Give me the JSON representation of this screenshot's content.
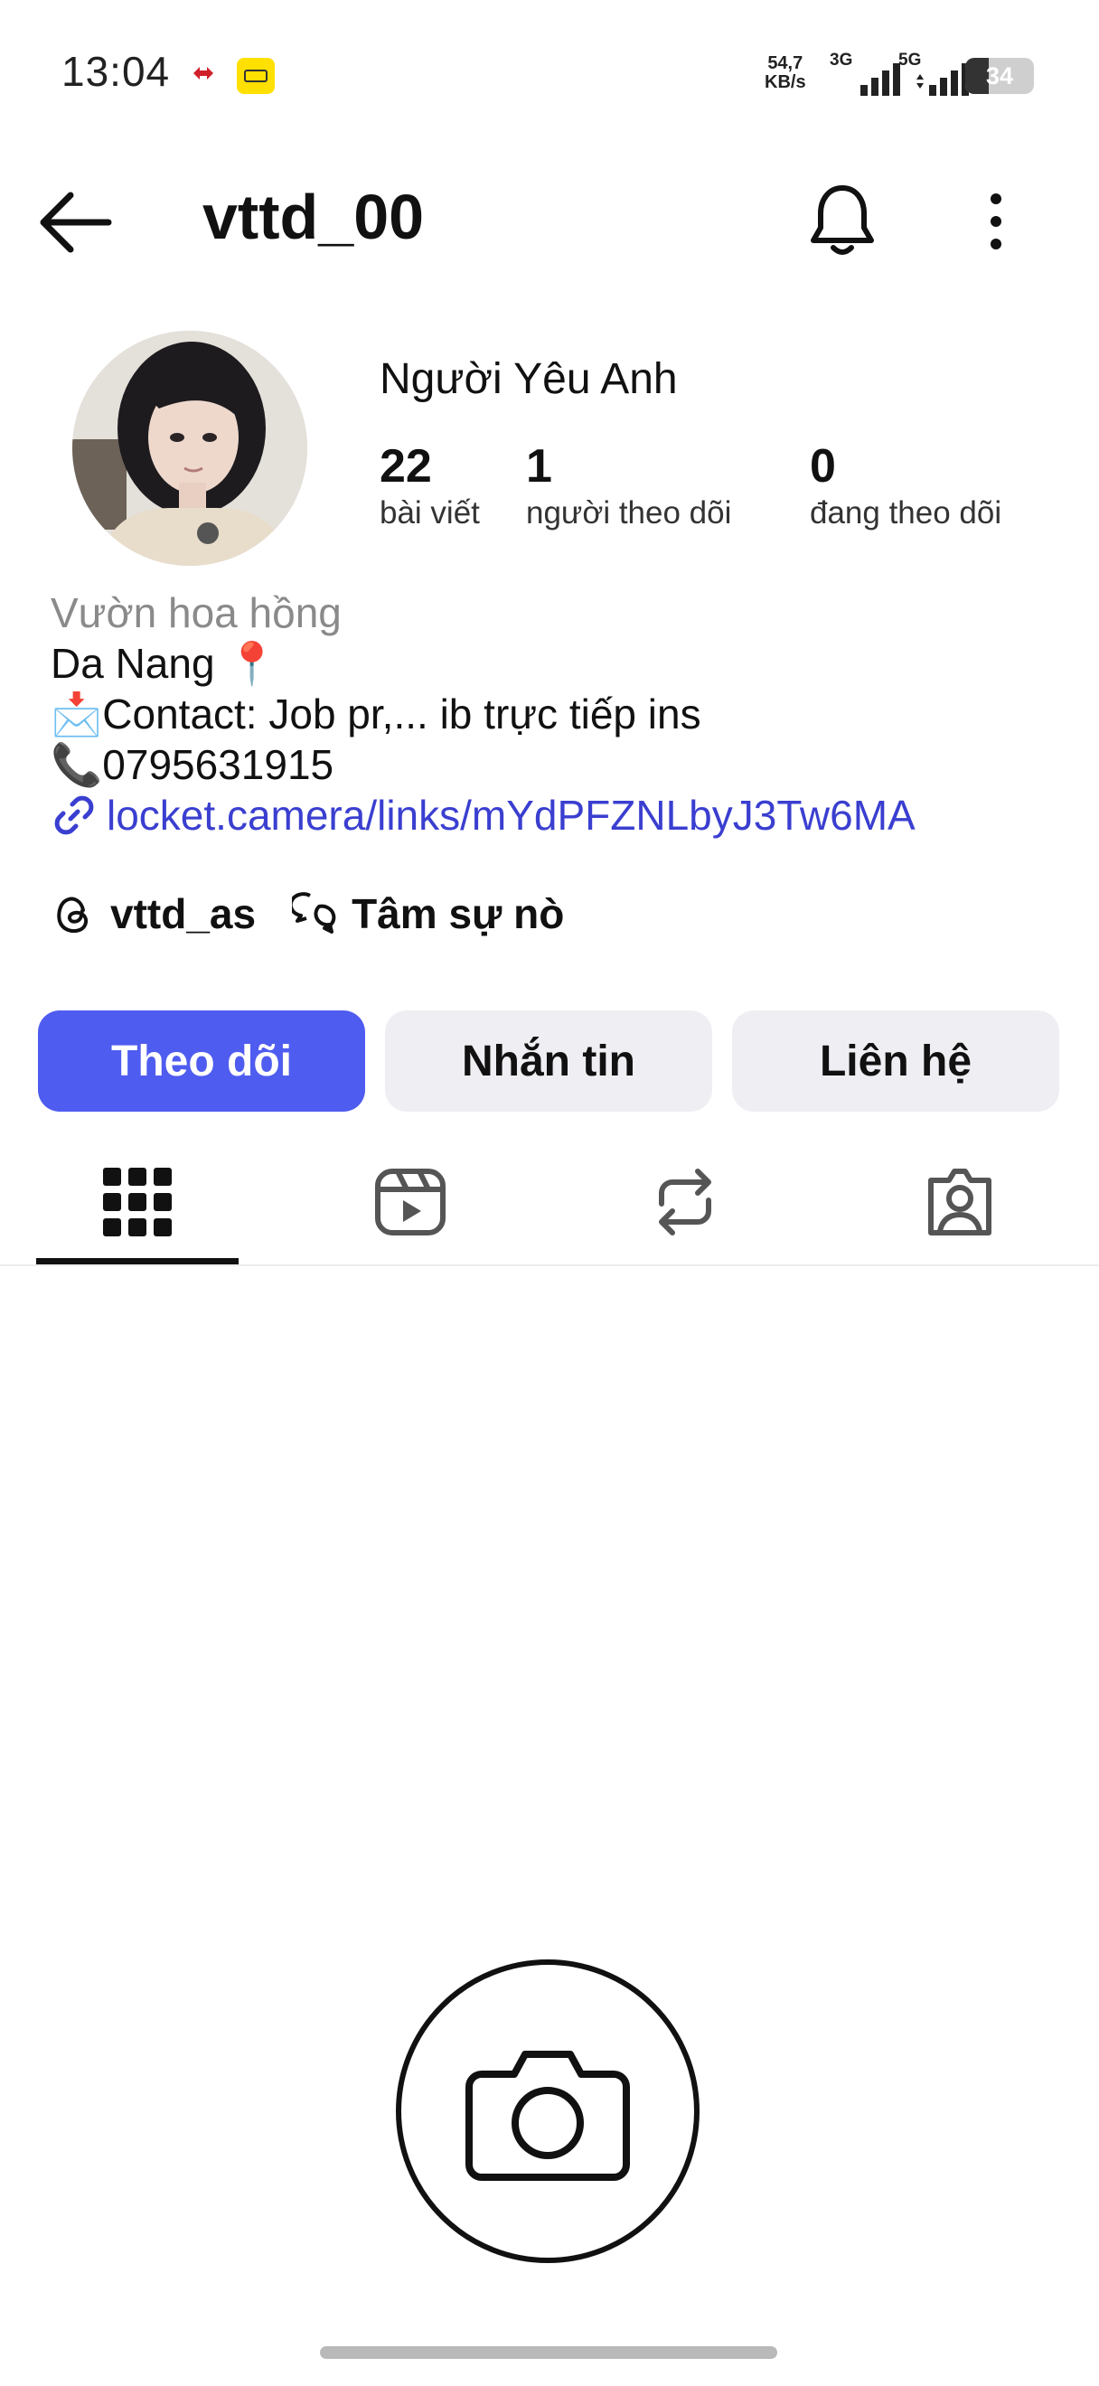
{
  "status_bar": {
    "time": "13:04",
    "net_speed_value": "54,7",
    "net_speed_unit": "KB/s",
    "sim1_label": "3G",
    "sim2_label": "5G",
    "battery_level": "34",
    "battery_fraction": 0.34
  },
  "header": {
    "username": "vttd_00",
    "back_icon": "arrow-left-icon",
    "bell_icon": "bell-icon",
    "more_icon": "more-vertical-icon"
  },
  "profile": {
    "display_name": "Người Yêu Anh",
    "stats": [
      {
        "value": "22",
        "label": "bài viết"
      },
      {
        "value": "1",
        "label": "người theo dõi"
      },
      {
        "value": "0",
        "label": "đang theo dõi"
      }
    ]
  },
  "bio": {
    "category": "Vườn hoa hồng",
    "line1": "Da Nang 📍",
    "line2": "📩Contact: Job pr,... ib trực tiếp ins",
    "line3": "📞0795631915",
    "link": "locket.camera/links/mYdPFZNLbyJ3Tw6MA"
  },
  "social": {
    "threads_handle": "vttd_as",
    "chat_label": "Tâm sự nò"
  },
  "actions": {
    "follow": "Theo dõi",
    "message": "Nhắn tin",
    "contact": "Liên hệ"
  },
  "tabs": [
    {
      "icon": "grid-icon",
      "active": true
    },
    {
      "icon": "reels-icon",
      "active": false
    },
    {
      "icon": "repost-icon",
      "active": false
    },
    {
      "icon": "tagged-icon",
      "active": false
    }
  ],
  "colors": {
    "accent": "#4f5cf0",
    "link": "#3a3fd0",
    "secondary_button": "#efeff3"
  }
}
